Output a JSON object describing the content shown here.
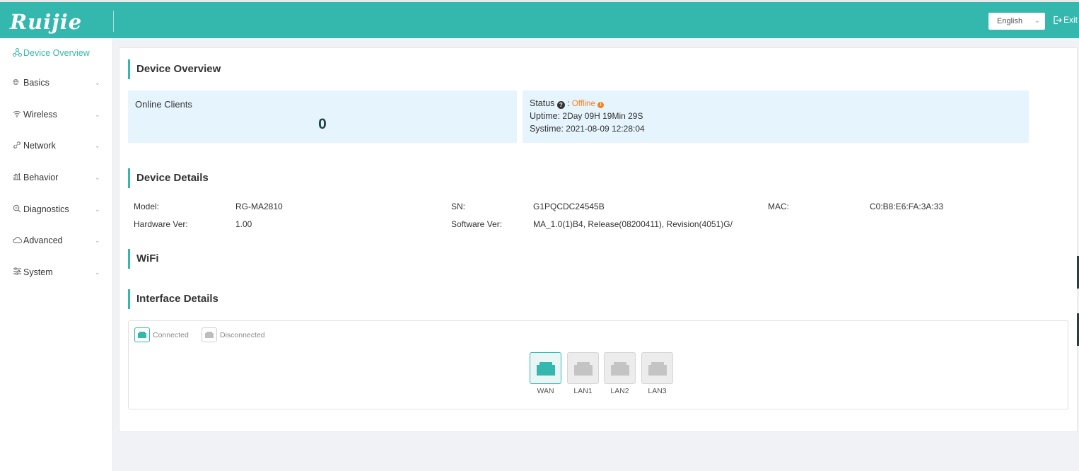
{
  "header": {
    "logo": "Ruijie",
    "language": "English",
    "exit_label": "Exit"
  },
  "sidebar": {
    "items": [
      {
        "label": "Device Overview",
        "icon": "topology-icon",
        "active": true
      },
      {
        "label": "Basics",
        "icon": "globe-icon"
      },
      {
        "label": "Wireless",
        "icon": "wifi-icon"
      },
      {
        "label": "Network",
        "icon": "link-icon"
      },
      {
        "label": "Behavior",
        "icon": "chart-icon"
      },
      {
        "label": "Diagnostics",
        "icon": "search-icon"
      },
      {
        "label": "Advanced",
        "icon": "cloud-icon"
      },
      {
        "label": "System",
        "icon": "settings-icon"
      }
    ]
  },
  "overview": {
    "title": "Device Overview",
    "online_clients_label": "Online Clients",
    "online_clients_value": "0",
    "status_label": "Status",
    "status_separator": ":",
    "status_value": "Offline",
    "uptime_label": "Uptime:",
    "uptime_value": "2Day 09H 19Min 29S",
    "systime_label": "Systime:",
    "systime_value": "2021-08-09 12:28:04"
  },
  "details": {
    "title": "Device Details",
    "model_label": "Model:",
    "model_value": "RG-MA2810",
    "sn_label": "SN:",
    "sn_value": "G1PQCDC24545B",
    "mac_label": "MAC:",
    "mac_value": "C0:B8:E6:FA:3A:33",
    "hw_label": "Hardware Ver:",
    "hw_value": "1.00",
    "sw_label": "Software Ver:",
    "sw_value": "MA_1.0(1)B4, Release(08200411), Revision(4051)G/"
  },
  "wifi": {
    "title": "WiFi"
  },
  "interfaces": {
    "title": "Interface Details",
    "legend_connected": "Connected",
    "legend_disconnected": "Disconnected",
    "ports": [
      {
        "label": "WAN",
        "connected": true
      },
      {
        "label": "LAN1",
        "connected": false
      },
      {
        "label": "LAN2",
        "connected": false
      },
      {
        "label": "LAN3",
        "connected": false
      }
    ]
  },
  "colors": {
    "brand": "#34b7ad",
    "offline": "#f5811f",
    "panel_bg": "#e6f4fd"
  }
}
